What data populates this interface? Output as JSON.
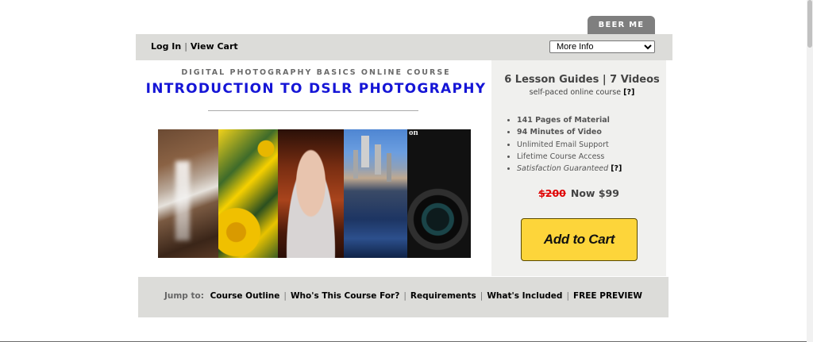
{
  "beer_tab": {
    "label": "BEER ME"
  },
  "topbar": {
    "login": "Log In",
    "separator": "|",
    "view_cart": "View Cart",
    "select_value": "More Info"
  },
  "course": {
    "subtitle": "DIGITAL PHOTOGRAPHY BASICS ONLINE COURSE",
    "title": "INTRODUCTION TO DSLR PHOTOGRAPHY"
  },
  "sidebar": {
    "lessons": "6 Lesson Guides | 7 Videos",
    "selfpaced": "self-paced online course",
    "help_marker": "[?]",
    "features": [
      "141 Pages of Material",
      "94 Minutes of Video",
      "Unlimited Email Support",
      "Lifetime Course Access",
      "Satisfaction Guaranteed"
    ],
    "old_price": "$200",
    "new_price": "Now $99",
    "add_to_cart": "Add to Cart"
  },
  "jumpbar": {
    "lead": "Jump to:",
    "separator": "|",
    "links": [
      "Course Outline",
      "Who's This Course For?",
      "Requirements",
      "What's Included",
      "FREE PREVIEW"
    ]
  }
}
